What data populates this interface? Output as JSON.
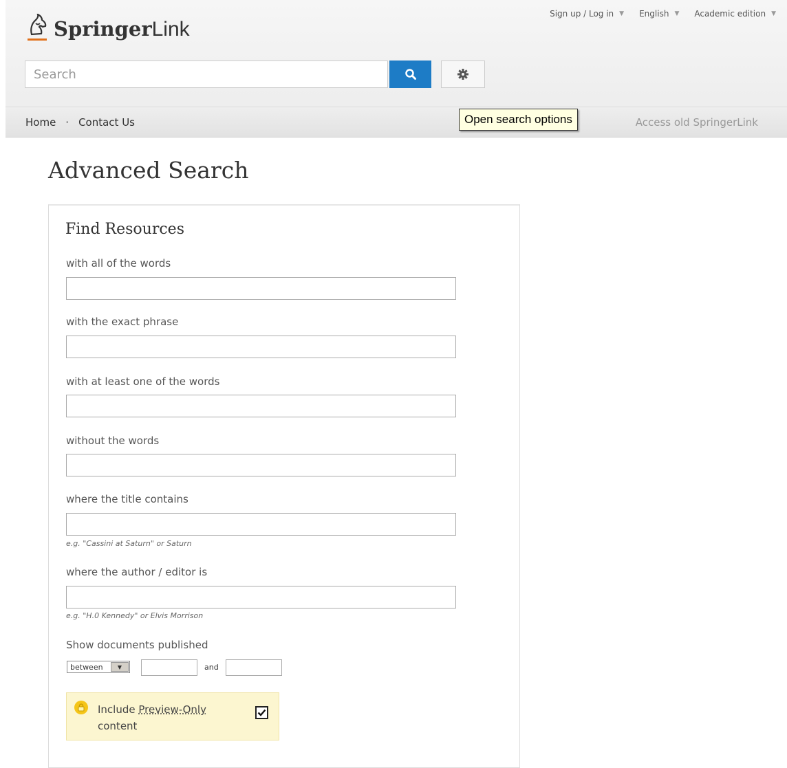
{
  "brand": {
    "name_bold": "Springer",
    "name_light": "Link"
  },
  "top_links": [
    {
      "label": "Sign up / Log in"
    },
    {
      "label": "English"
    },
    {
      "label": "Academic edition"
    }
  ],
  "search": {
    "placeholder": "Search",
    "value": ""
  },
  "nav": {
    "home": "Home",
    "separator": "·",
    "contact": "Contact Us",
    "old_link": "Access old SpringerLink"
  },
  "tooltip": "Open search options",
  "page": {
    "title": "Advanced Search"
  },
  "form": {
    "title": "Find Resources",
    "fields": [
      {
        "label": "with all of the words",
        "value": ""
      },
      {
        "label": "with the exact phrase",
        "value": ""
      },
      {
        "label": "with at least one of the words",
        "value": ""
      },
      {
        "label": "without the words",
        "value": ""
      },
      {
        "label": "where the title contains",
        "value": "",
        "hint": "e.g. \"Cassini at Saturn\" or Saturn"
      },
      {
        "label": "where the author / editor is",
        "value": "",
        "hint": "e.g. \"H.0 Kennedy\" or Elvis Morrison"
      }
    ],
    "date": {
      "label": "Show documents published",
      "mode": "between",
      "from": "",
      "and_label": "and",
      "to": ""
    },
    "preview": {
      "text_before": "Include",
      "link": "Preview-Only",
      "text_after": "content",
      "checked": true
    }
  },
  "colors": {
    "accent": "#1d7cc6",
    "preview_bg": "#fcf6d0",
    "tooltip_bg": "#ffffe1"
  }
}
